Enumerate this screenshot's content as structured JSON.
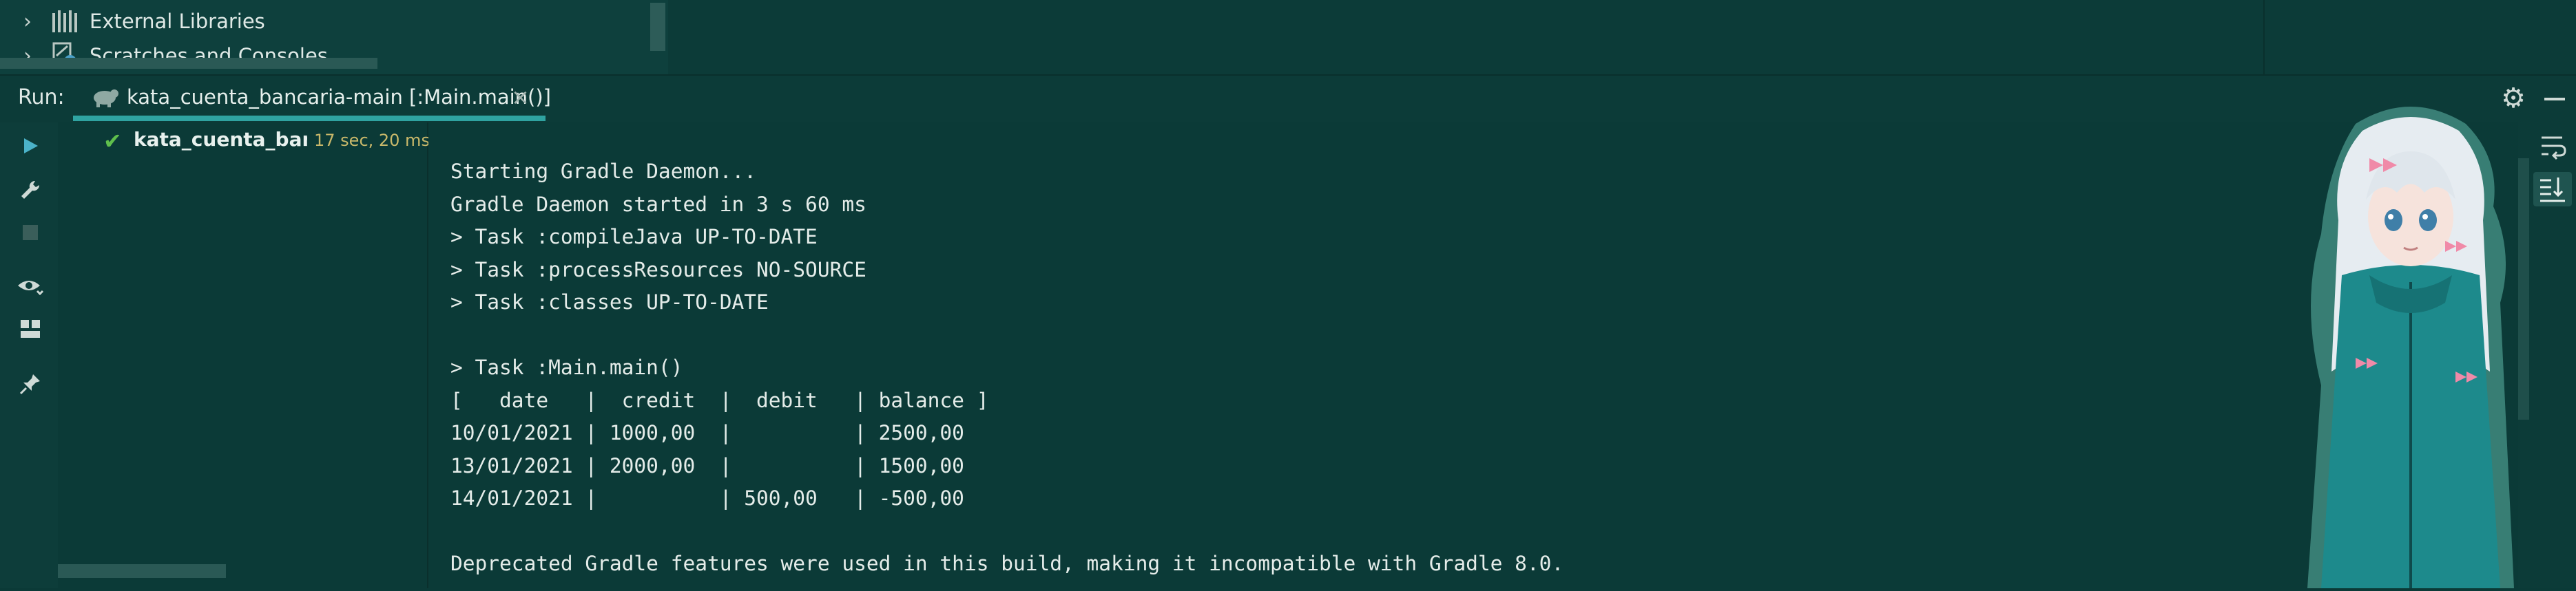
{
  "project_tree": {
    "items": [
      {
        "label": "External Libraries",
        "icon": "libraries-icon"
      },
      {
        "label": "Scratches and Consoles",
        "icon": "scratches-icon"
      }
    ]
  },
  "run_window": {
    "label": "Run:",
    "tab": {
      "label": "kata_cuenta_bancaria-main [:Main.main()]",
      "close": "×"
    },
    "gear": "⚙"
  },
  "results": {
    "name": "kata_cuenta_bancaria-main",
    "time": "17 sec, 20 ms",
    "status": "success"
  },
  "console": {
    "lines": [
      "Starting Gradle Daemon...",
      "Gradle Daemon started in 3 s 60 ms",
      "> Task :compileJava UP-TO-DATE",
      "> Task :processResources NO-SOURCE",
      "> Task :classes UP-TO-DATE",
      "",
      "> Task :Main.main()",
      "[   date   |  credit  |  debit   | balance ]",
      "10/01/2021 | 1000,00  |          | 2500,00",
      "13/01/2021 | 2000,00  |          | 1500,00",
      "14/01/2021 |          | 500,00   | -500,00",
      "",
      "Deprecated Gradle features were used in this build, making it incompatible with Gradle 8.0."
    ]
  },
  "colors": {
    "background": "#0b3a37",
    "accent": "#2fa3a1",
    "success": "#5fbf4c",
    "time_text": "#c9b86a"
  }
}
